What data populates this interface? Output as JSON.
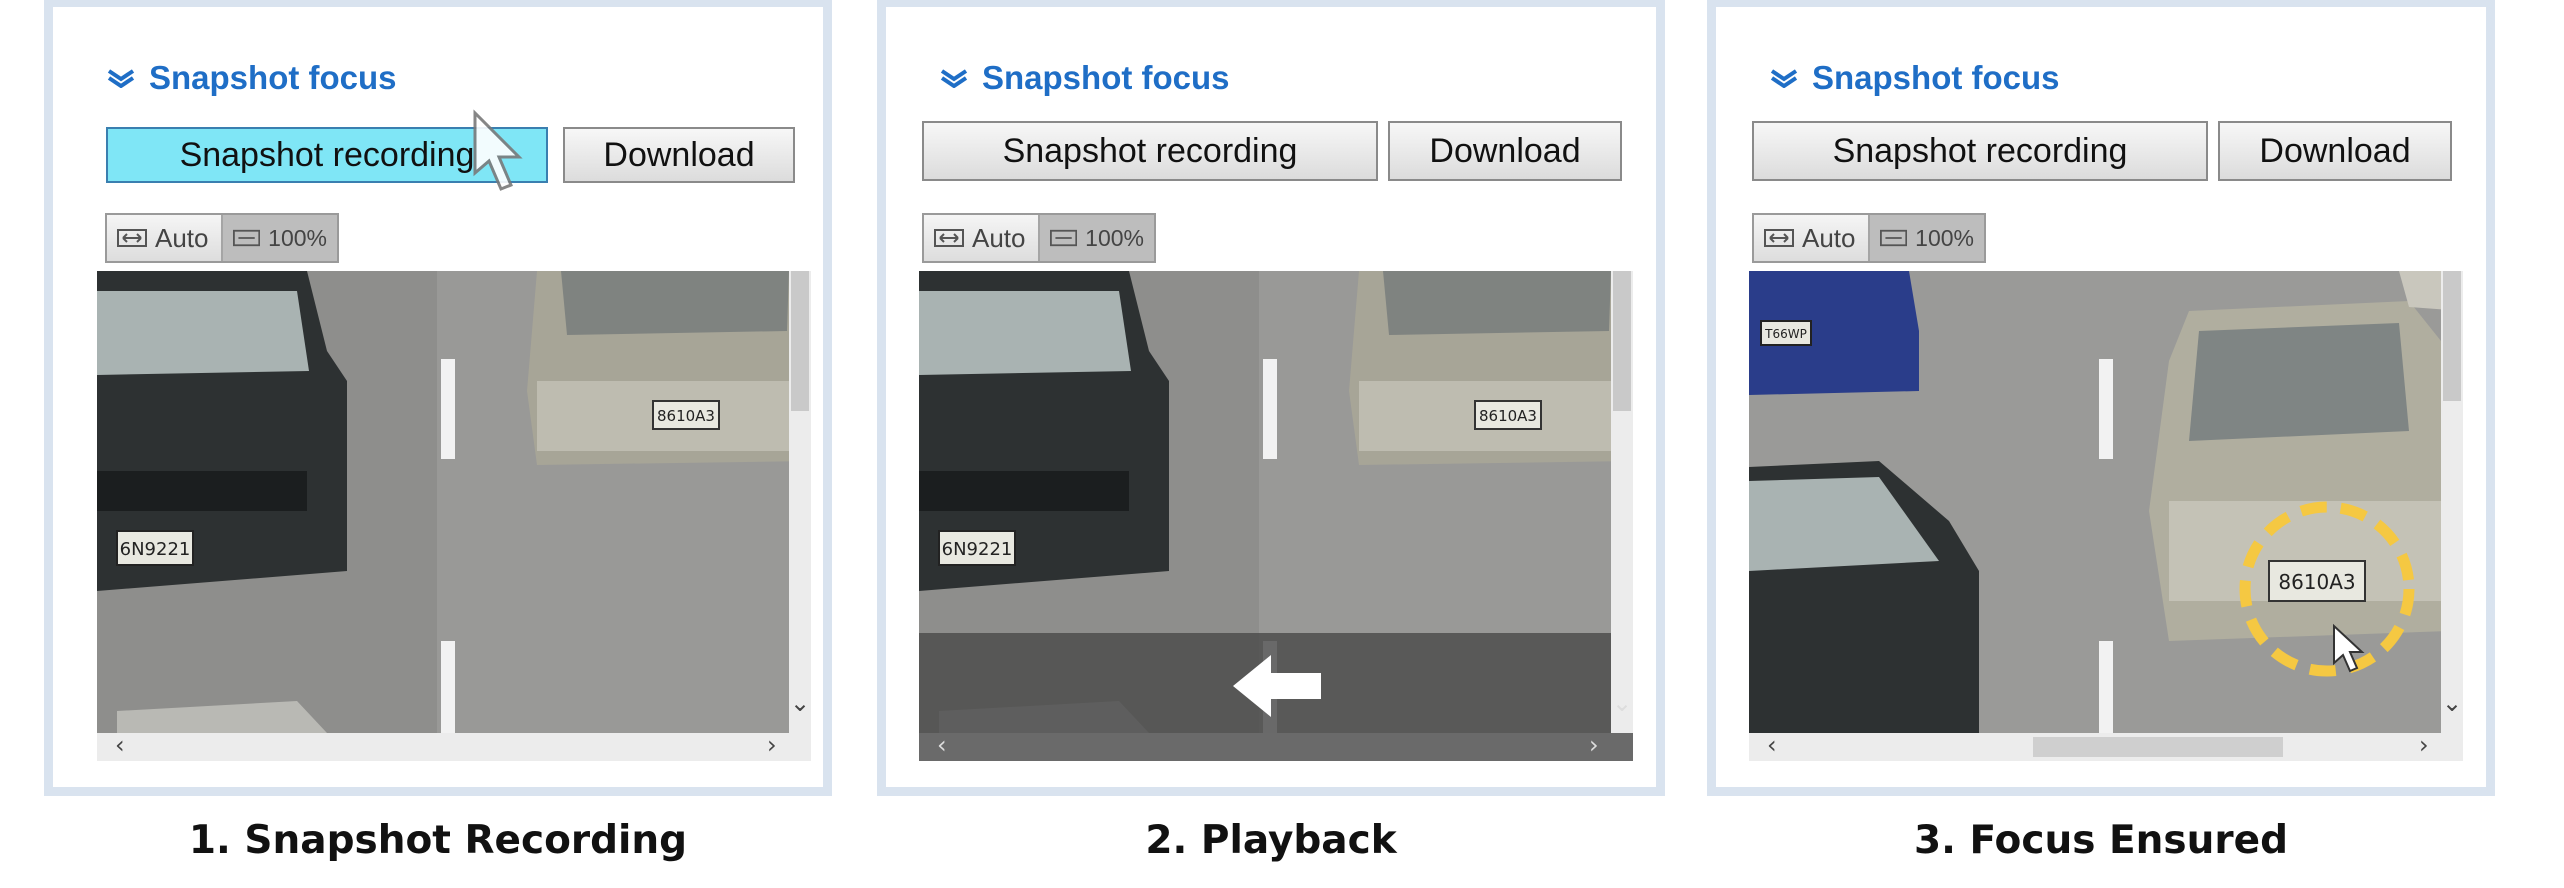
{
  "panels": [
    {
      "section_title": "Snapshot focus",
      "record_button_label": "Snapshot recording",
      "download_button_label": "Download",
      "zoom_auto_label": "Auto",
      "zoom_100_label": "100%",
      "caption": "1. Snapshot Recording"
    },
    {
      "section_title": "Snapshot focus",
      "record_button_label": "Snapshot recording",
      "download_button_label": "Download",
      "zoom_auto_label": "Auto",
      "zoom_100_label": "100%",
      "caption": "2. Playback"
    },
    {
      "section_title": "Snapshot focus",
      "record_button_label": "Snapshot recording",
      "download_button_label": "Download",
      "zoom_auto_label": "Auto",
      "zoom_100_label": "100%",
      "caption": "3. Focus Ensured"
    }
  ],
  "plates": {
    "front_car": "6N9221",
    "silver_car": "8610A3",
    "blue_car": "T66WP"
  },
  "colors": {
    "title_blue": "#1f6ec6",
    "active_button": "#7fe6f6",
    "highlight_ring": "#f5c842",
    "panel_border": "#d9e3ef"
  },
  "icons": {
    "section": "double-chevron-down-icon",
    "cursor": "mouse-pointer-icon",
    "playback": "left-arrow-icon"
  }
}
